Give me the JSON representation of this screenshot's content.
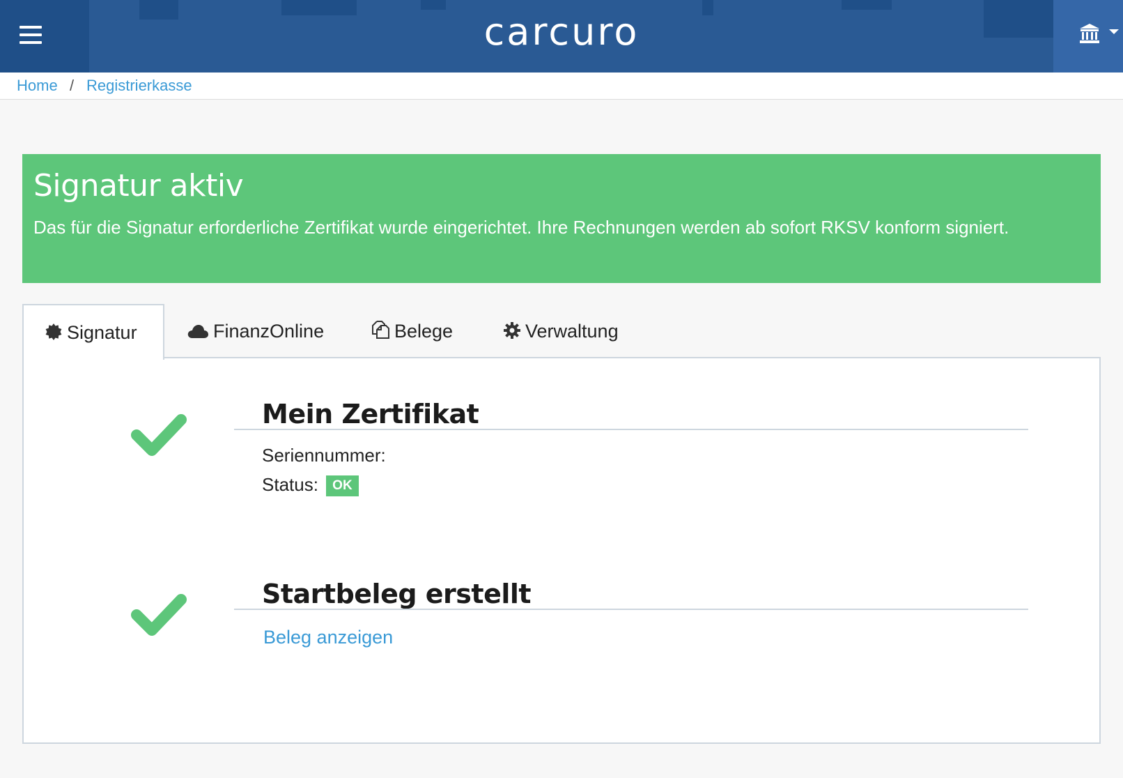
{
  "header": {
    "brand": "carcuro",
    "menu_icon": "hamburger-icon",
    "bank_icon": "bank-icon"
  },
  "breadcrumb": {
    "home": "Home",
    "separator": "/",
    "current": "Registrierkasse"
  },
  "alert": {
    "title": "Signatur aktiv",
    "message": "Das für die Signatur erforderliche Zertifikat wurde eingerichtet. Ihre Rechnungen werden ab sofort RKSV konform signiert.",
    "color": "#5dc67a"
  },
  "tabs": [
    {
      "label": "Signatur",
      "icon": "certificate-icon",
      "active": true
    },
    {
      "label": "FinanzOnline",
      "icon": "cloud-icon",
      "active": false
    },
    {
      "label": "Belege",
      "icon": "copy-icon",
      "active": false
    },
    {
      "label": "Verwaltung",
      "icon": "gear-icon",
      "active": false
    }
  ],
  "certificate": {
    "title": "Mein Zertifikat",
    "serial_label": "Seriennummer:",
    "status_label": "Status:",
    "status_value": "OK",
    "check_icon": "check-icon"
  },
  "startbeleg": {
    "title": "Startbeleg erstellt",
    "link": "Beleg anzeigen",
    "check_icon": "check-icon"
  },
  "colors": {
    "header": "#2a5a94",
    "link": "#3a9ad6",
    "success": "#5dc67a"
  }
}
